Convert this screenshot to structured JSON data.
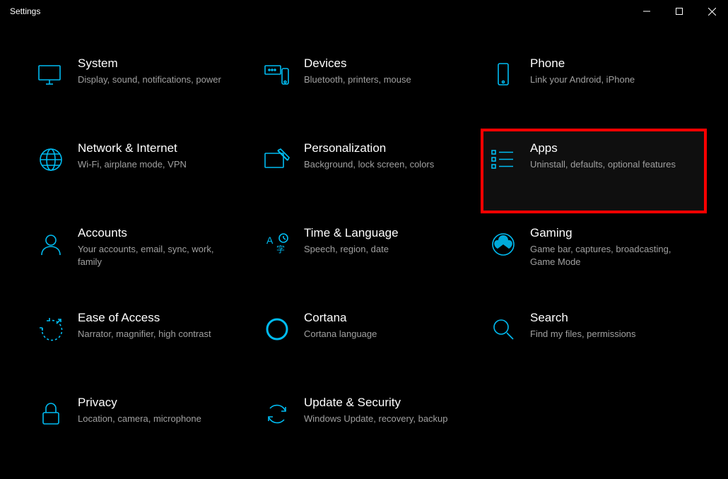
{
  "window": {
    "title": "Settings"
  },
  "accent": "#00bcf2",
  "categories": [
    {
      "id": "system",
      "title": "System",
      "subtitle": "Display, sound, notifications, power"
    },
    {
      "id": "devices",
      "title": "Devices",
      "subtitle": "Bluetooth, printers, mouse"
    },
    {
      "id": "phone",
      "title": "Phone",
      "subtitle": "Link your Android, iPhone"
    },
    {
      "id": "network",
      "title": "Network & Internet",
      "subtitle": "Wi-Fi, airplane mode, VPN"
    },
    {
      "id": "personalization",
      "title": "Personalization",
      "subtitle": "Background, lock screen, colors"
    },
    {
      "id": "apps",
      "title": "Apps",
      "subtitle": "Uninstall, defaults, optional features",
      "highlighted": true
    },
    {
      "id": "accounts",
      "title": "Accounts",
      "subtitle": "Your accounts, email, sync, work, family"
    },
    {
      "id": "time",
      "title": "Time & Language",
      "subtitle": "Speech, region, date"
    },
    {
      "id": "gaming",
      "title": "Gaming",
      "subtitle": "Game bar, captures, broadcasting, Game Mode"
    },
    {
      "id": "ease",
      "title": "Ease of Access",
      "subtitle": "Narrator, magnifier, high contrast"
    },
    {
      "id": "cortana",
      "title": "Cortana",
      "subtitle": "Cortana language"
    },
    {
      "id": "search",
      "title": "Search",
      "subtitle": "Find my files, permissions"
    },
    {
      "id": "privacy",
      "title": "Privacy",
      "subtitle": "Location, camera, microphone"
    },
    {
      "id": "update",
      "title": "Update & Security",
      "subtitle": "Windows Update, recovery, backup"
    }
  ]
}
